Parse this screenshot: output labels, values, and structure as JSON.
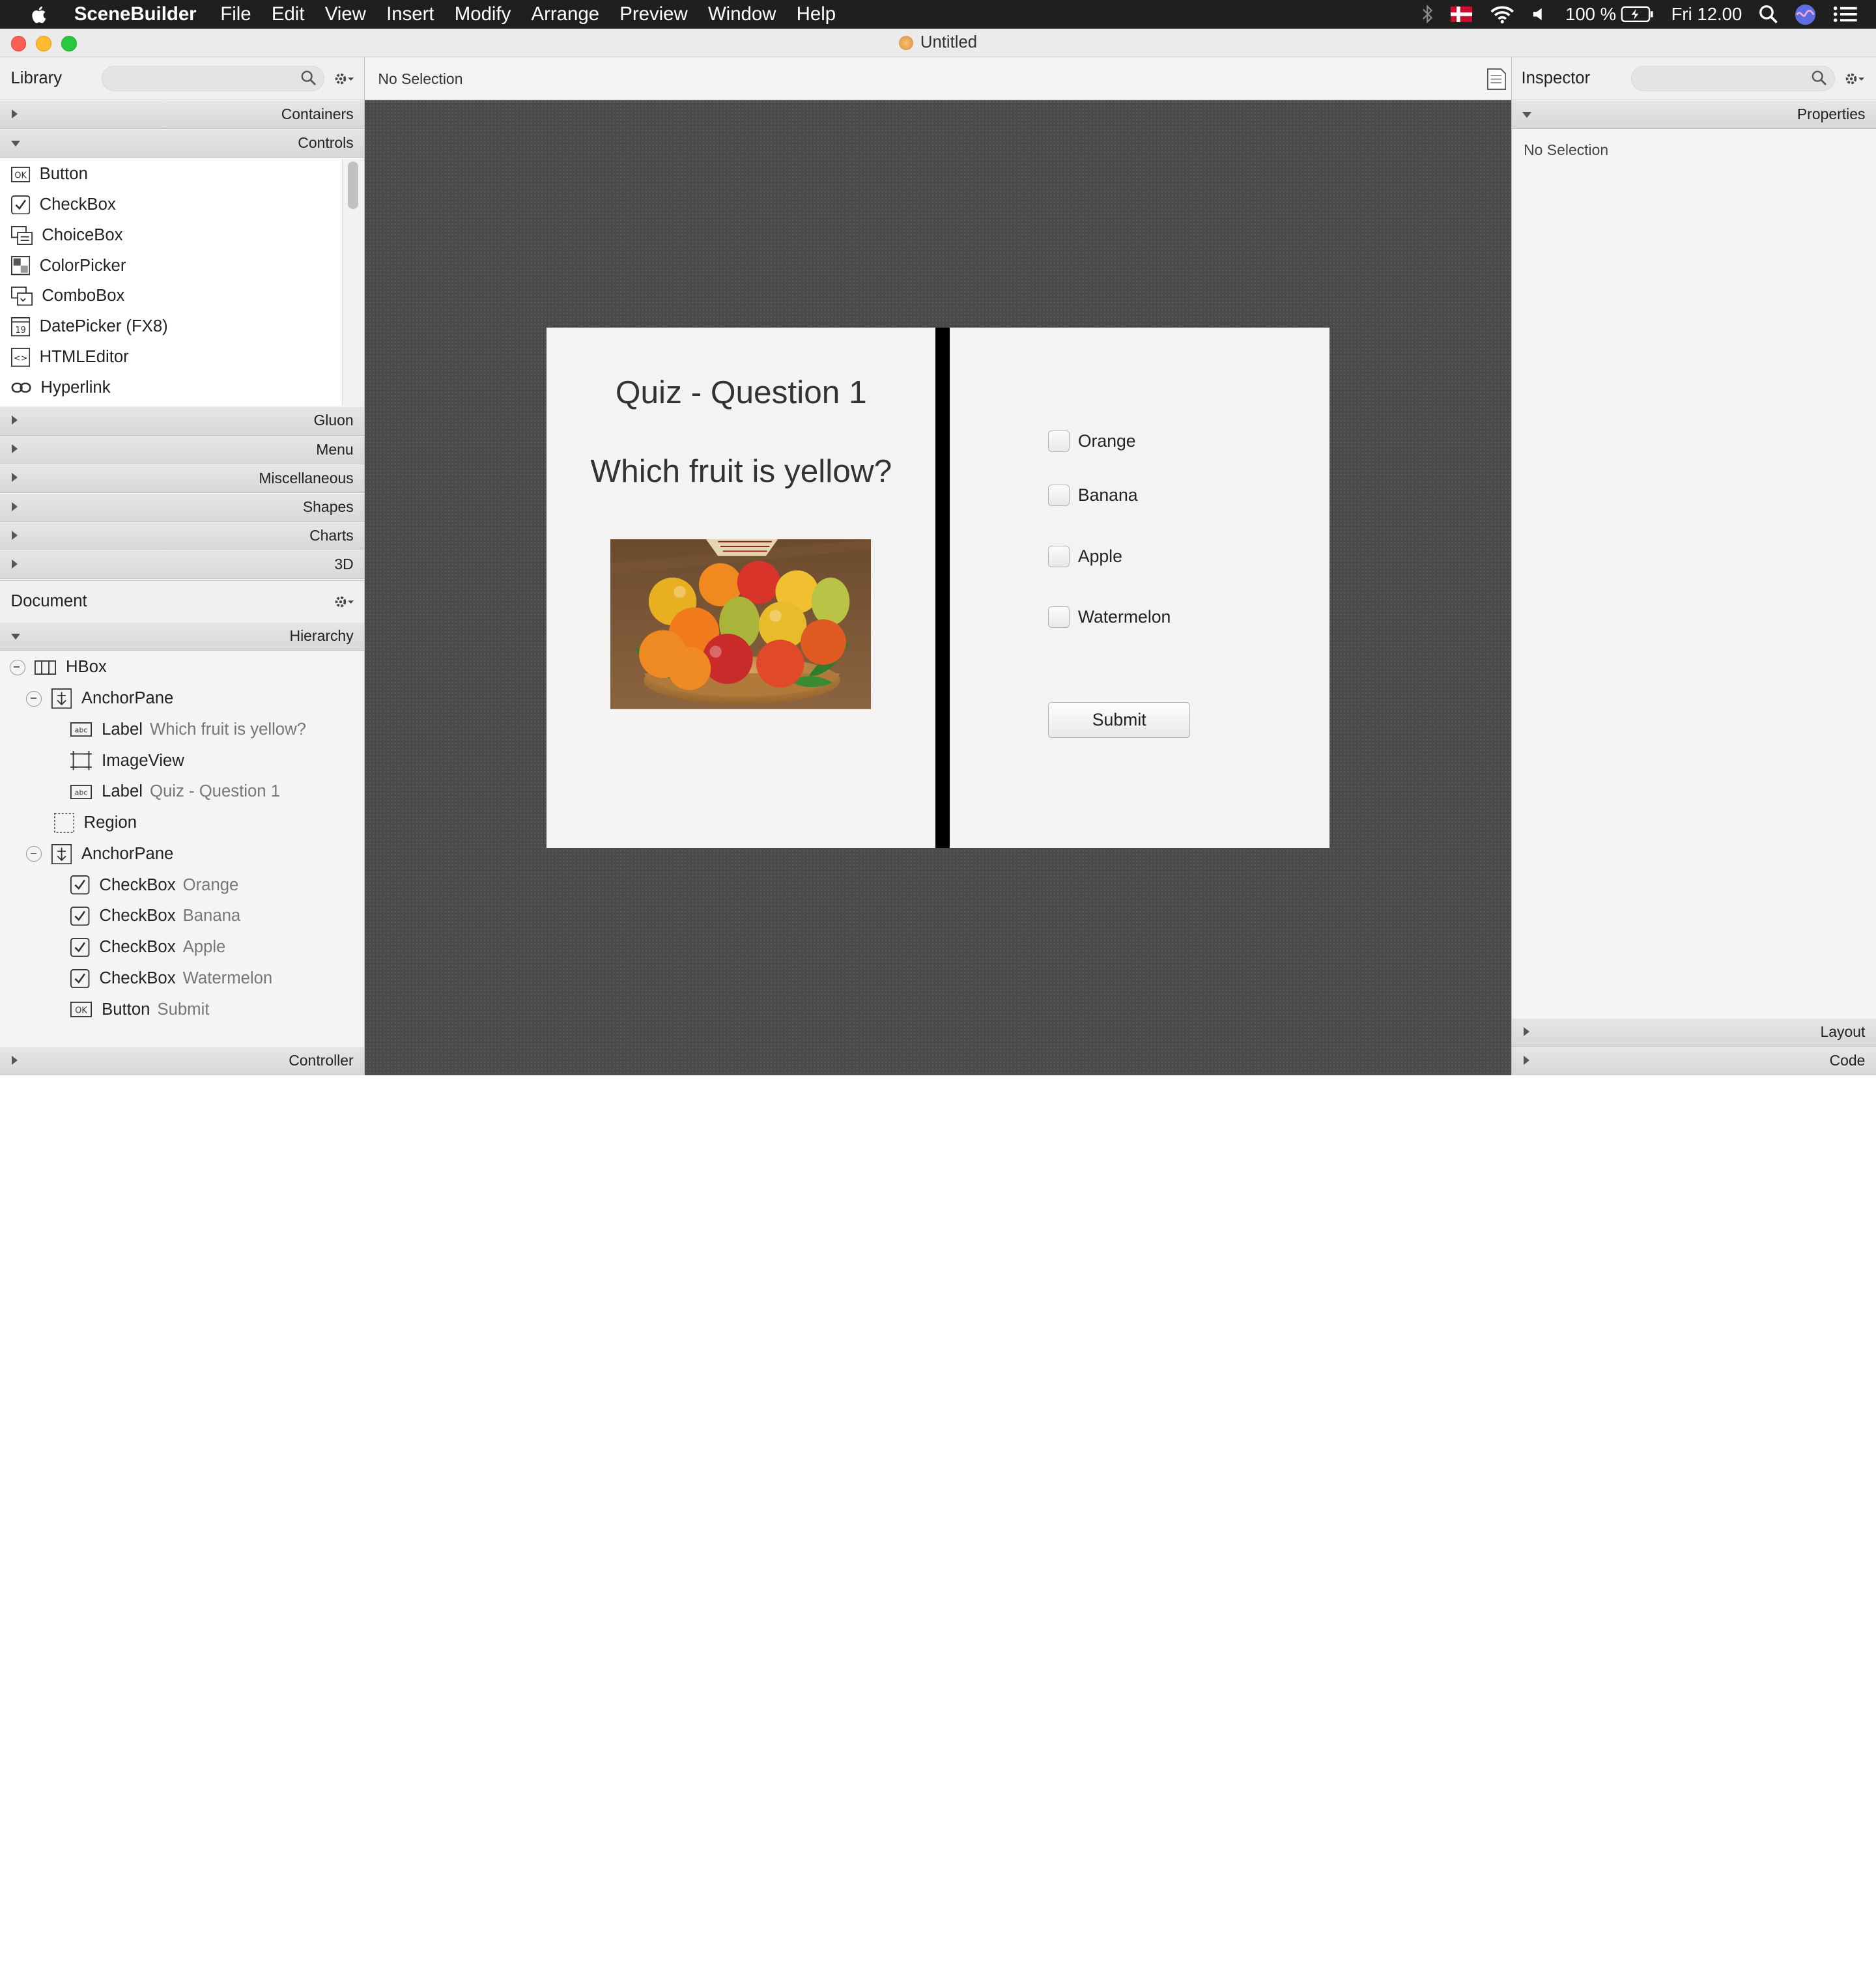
{
  "menubar": {
    "app_name": "SceneBuilder",
    "items": [
      "File",
      "Edit",
      "View",
      "Insert",
      "Modify",
      "Arrange",
      "Preview",
      "Window",
      "Help"
    ],
    "battery": "100 %",
    "clock": "Fri 12.00"
  },
  "window": {
    "title": "Untitled"
  },
  "library": {
    "title": "Library",
    "search_placeholder": "",
    "sections_top": [
      "Containers",
      "Controls"
    ],
    "controls": [
      {
        "label": "Button",
        "icon": "button-icon"
      },
      {
        "label": "CheckBox",
        "icon": "checkbox-icon"
      },
      {
        "label": "ChoiceBox",
        "icon": "choicebox-icon"
      },
      {
        "label": "ColorPicker",
        "icon": "colorpicker-icon"
      },
      {
        "label": "ComboBox",
        "icon": "combobox-icon"
      },
      {
        "label": "DatePicker  (FX8)",
        "icon": "datepicker-icon"
      },
      {
        "label": "HTMLEditor",
        "icon": "htmleditor-icon"
      },
      {
        "label": "Hyperlink",
        "icon": "hyperlink-icon"
      }
    ],
    "sections_bottom": [
      "Gluon",
      "Menu",
      "Miscellaneous",
      "Shapes",
      "Charts",
      "3D"
    ]
  },
  "document": {
    "title": "Document",
    "hierarchy_label": "Hierarchy",
    "controller_label": "Controller",
    "tree": [
      {
        "type": "HBox",
        "text": ""
      },
      {
        "type": "AnchorPane",
        "text": ""
      },
      {
        "type": "Label",
        "text": "Which fruit is yellow?"
      },
      {
        "type": "ImageView",
        "text": ""
      },
      {
        "type": "Label",
        "text": "Quiz - Question 1"
      },
      {
        "type": "Region",
        "text": ""
      },
      {
        "type": "AnchorPane",
        "text": ""
      },
      {
        "type": "CheckBox",
        "text": "Orange"
      },
      {
        "type": "CheckBox",
        "text": "Banana"
      },
      {
        "type": "CheckBox",
        "text": "Apple"
      },
      {
        "type": "CheckBox",
        "text": "Watermelon"
      },
      {
        "type": "Button",
        "text": "Submit"
      }
    ]
  },
  "center": {
    "selection_status": "No Selection"
  },
  "quiz": {
    "title": "Quiz - Question 1",
    "question": "Which fruit is yellow?",
    "options": [
      "Orange",
      "Banana",
      "Apple",
      "Watermelon"
    ],
    "submit_label": "Submit"
  },
  "inspector": {
    "title": "Inspector",
    "properties_label": "Properties",
    "status": "No Selection",
    "layout_label": "Layout",
    "code_label": "Code"
  }
}
